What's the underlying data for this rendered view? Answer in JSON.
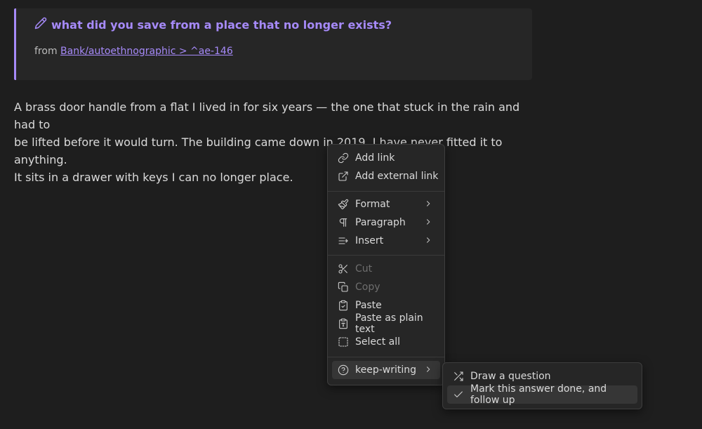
{
  "callout": {
    "title": "what did you save from a place that no longer exists?",
    "from_prefix": "from",
    "link_text": "Bank/autoethnographic > ^ae-146",
    "accent_color": "#a68af9",
    "icon": "pencil-icon"
  },
  "body": {
    "line1": "A brass door handle from a flat I lived in for six years — the one that stuck in the rain and had to",
    "line2": "be lifted before it would turn. The building came down in 2019. I have never fitted it to anything.",
    "line3": "It sits in a drawer with keys I can no longer place."
  },
  "context_menu": {
    "items": [
      {
        "label": "Add link",
        "icon": "link-icon"
      },
      {
        "label": "Add external link",
        "icon": "external-link-icon"
      },
      {
        "label": "Format",
        "icon": "paintbrush-icon",
        "submenu": true
      },
      {
        "label": "Paragraph",
        "icon": "pilcrow-icon",
        "submenu": true
      },
      {
        "label": "Insert",
        "icon": "insert-icon",
        "submenu": true
      },
      {
        "label": "Cut",
        "icon": "scissors-icon",
        "disabled": true
      },
      {
        "label": "Copy",
        "icon": "copy-icon",
        "disabled": true
      },
      {
        "label": "Paste",
        "icon": "clipboard-check-icon"
      },
      {
        "label": "Paste as plain text",
        "icon": "clipboard-type-icon"
      },
      {
        "label": "Select all",
        "icon": "select-all-icon"
      },
      {
        "label": "keep-writing",
        "icon": "help-circle-icon",
        "submenu": true,
        "active": true
      }
    ]
  },
  "submenu": {
    "items": [
      {
        "label": "Draw a question",
        "icon": "shuffle-icon"
      },
      {
        "label": "Mark this answer done, and follow up",
        "icon": "check-icon",
        "active": true
      }
    ]
  }
}
